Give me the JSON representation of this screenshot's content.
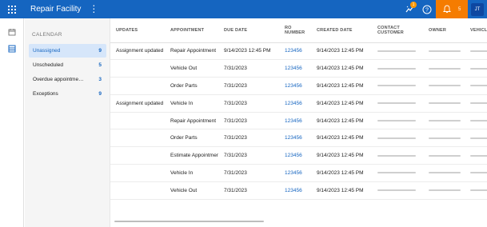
{
  "header": {
    "app_title": "Repair Facility",
    "menu_icon": "more-vert-icon",
    "grid_icon": "apps-grid-icon",
    "activity_badge": "1",
    "notification_count": "5",
    "user_initials": "JT",
    "brand_color": "#1565c0",
    "notification_color": "#f57c00"
  },
  "rail": {
    "items": [
      {
        "icon": "calendar-icon"
      },
      {
        "icon": "list-view-icon"
      }
    ]
  },
  "sidebar": {
    "heading": "CALENDAR",
    "items": [
      {
        "label": "Unassigned",
        "count": "9"
      },
      {
        "label": "Unscheduled",
        "count": "5"
      },
      {
        "label": "Overdue appointme…",
        "count": "3"
      },
      {
        "label": "Exceptions",
        "count": "9"
      }
    ]
  },
  "table": {
    "columns": [
      "UPDATES",
      "APPOINTMENT",
      "DUE DATE",
      "RO NUMBER",
      "CREATED DATE",
      "CONTACT CUSTOMER",
      "OWNER",
      "VEHICLE"
    ],
    "rows": [
      {
        "updates": "Assignment updated",
        "appointment": "Repair Appointment",
        "due": "9/14/2023 12:45 PM",
        "ro": "123456",
        "created": "9/14/2023 12:45 PM"
      },
      {
        "updates": "",
        "appointment": "Vehicle Out",
        "due": "7/31/2023",
        "ro": "123456",
        "created": "9/14/2023 12:45 PM"
      },
      {
        "updates": "",
        "appointment": "Order Parts",
        "due": "7/31/2023",
        "ro": "123456",
        "created": "9/14/2023 12:45 PM"
      },
      {
        "updates": "Assignment updated",
        "appointment": "Vehicle In",
        "due": "7/31/2023",
        "ro": "123456",
        "created": "9/14/2023 12:45 PM"
      },
      {
        "updates": "",
        "appointment": "Repair Appointment",
        "due": "7/31/2023",
        "ro": "123456",
        "created": "9/14/2023 12:45 PM"
      },
      {
        "updates": "",
        "appointment": "Order Parts",
        "due": "7/31/2023",
        "ro": "123456",
        "created": "9/14/2023 12:45 PM"
      },
      {
        "updates": "",
        "appointment": "Estimate Appointment",
        "due": "7/31/2023",
        "ro": "123456",
        "created": "9/14/2023 12:45 PM"
      },
      {
        "updates": "",
        "appointment": "Vehicle In",
        "due": "7/31/2023",
        "ro": "123456",
        "created": "9/14/2023 12:45 PM"
      },
      {
        "updates": "",
        "appointment": "Vehicle Out",
        "due": "7/31/2023",
        "ro": "123456",
        "created": "9/14/2023 12:45 PM"
      }
    ]
  }
}
